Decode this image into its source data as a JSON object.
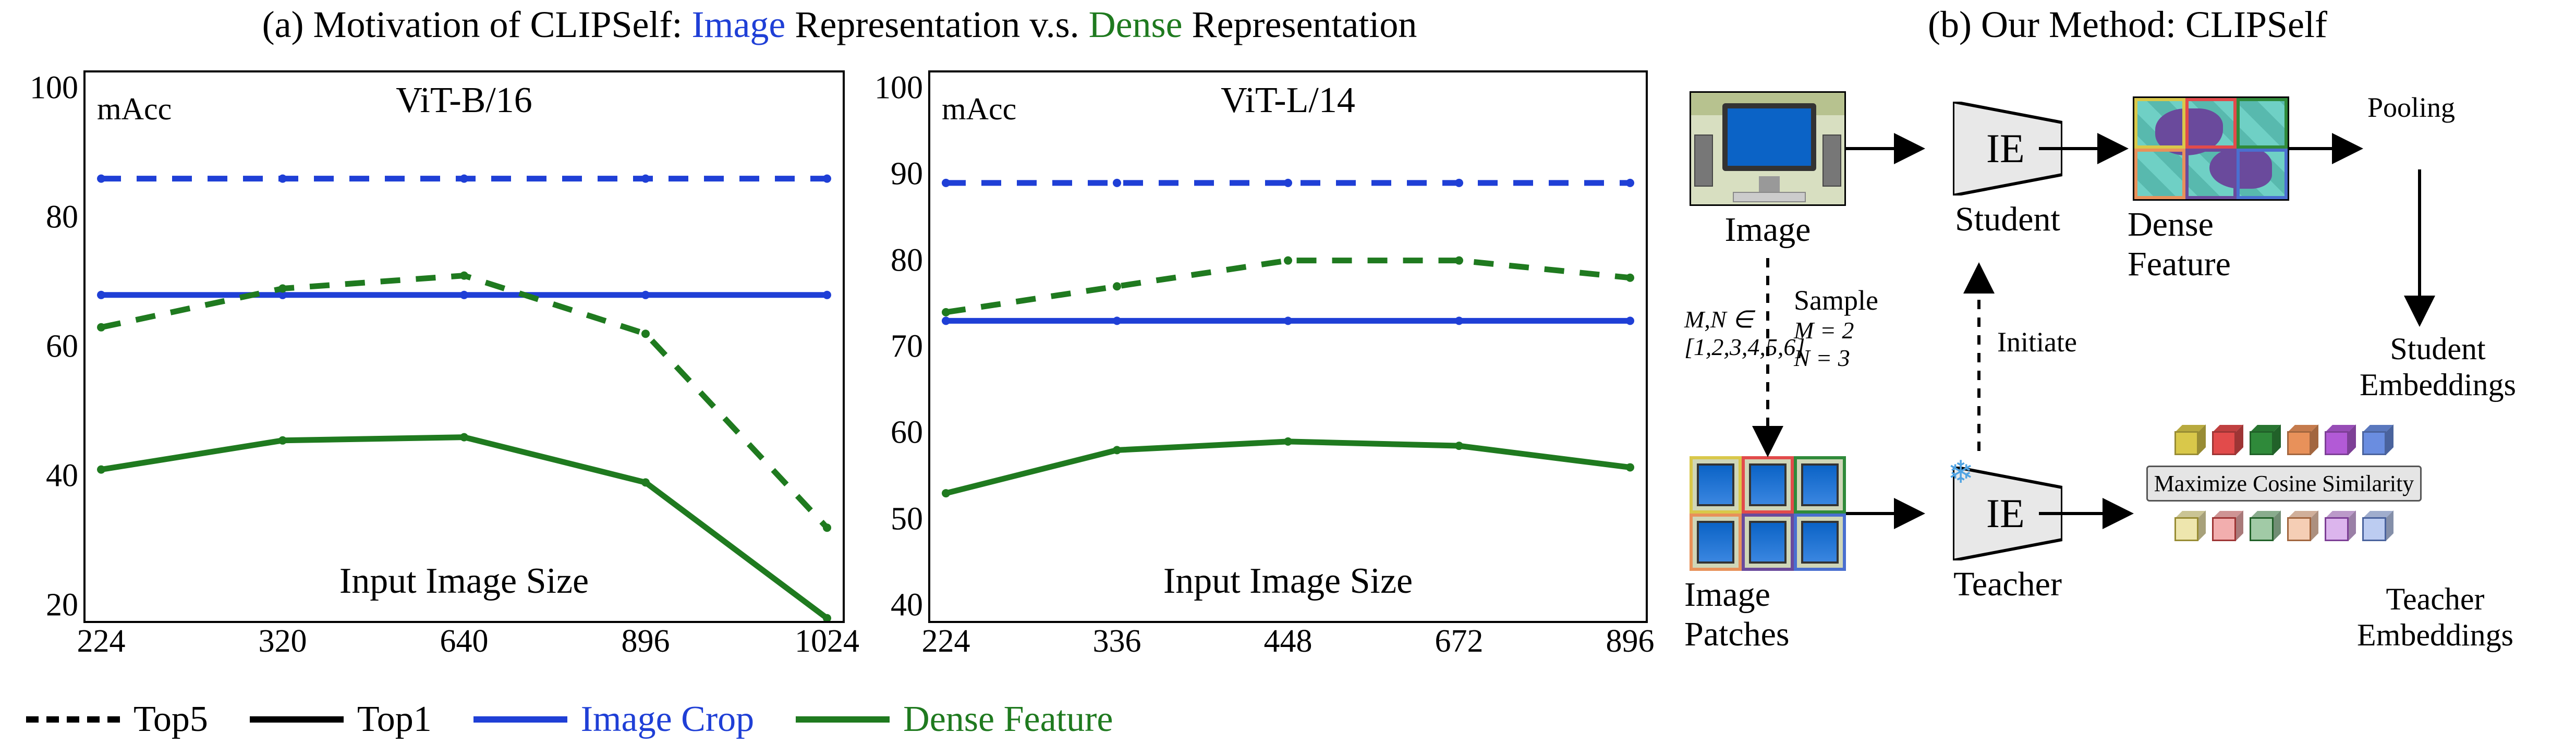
{
  "captions": {
    "a_pre": "(a) Motivation of CLIPSelf: ",
    "a_img": "Image",
    "a_mid": " Representation v.s. ",
    "a_dense": "Dense",
    "a_post": " Representation",
    "b": "(b) Our Method: CLIPSelf"
  },
  "legend": {
    "top5": "Top5",
    "top1": "Top1",
    "image_crop": "Image Crop",
    "dense_feature": "Dense Feature"
  },
  "chart_data": [
    {
      "type": "line",
      "title": "ViT-B/16",
      "macc": "mAcc",
      "xlabel": "Input Image Size",
      "ylabel": "",
      "ylim": [
        20,
        100
      ],
      "xticks": [
        "224",
        "320",
        "640",
        "896",
        "1024"
      ],
      "yticks": [
        20,
        40,
        60,
        80,
        100
      ],
      "series": [
        {
          "name": "Image Crop Top5",
          "color": "#1f3fd6",
          "dash": true,
          "values": [
            86,
            86,
            86,
            86,
            86
          ]
        },
        {
          "name": "Image Crop Top1",
          "color": "#1f3fd6",
          "dash": false,
          "values": [
            68,
            68,
            68,
            68,
            68
          ]
        },
        {
          "name": "Dense Feature Top5",
          "color": "#1f7a1f",
          "dash": true,
          "values": [
            63,
            69,
            71,
            62,
            32
          ]
        },
        {
          "name": "Dense Feature Top1",
          "color": "#1f7a1f",
          "dash": false,
          "values": [
            41,
            45.5,
            46,
            39,
            18
          ]
        }
      ]
    },
    {
      "type": "line",
      "title": "ViT-L/14",
      "macc": "mAcc",
      "xlabel": "Input Image Size",
      "ylabel": "",
      "ylim": [
        40,
        100
      ],
      "xticks": [
        "224",
        "336",
        "448",
        "672",
        "896"
      ],
      "yticks": [
        40,
        50,
        60,
        70,
        80,
        90,
        100
      ],
      "series": [
        {
          "name": "Image Crop Top5",
          "color": "#1f3fd6",
          "dash": true,
          "values": [
            89,
            89,
            89,
            89,
            89
          ]
        },
        {
          "name": "Image Crop Top1",
          "color": "#1f3fd6",
          "dash": false,
          "values": [
            73,
            73,
            73,
            73,
            73
          ]
        },
        {
          "name": "Dense Feature Top5",
          "color": "#1f7a1f",
          "dash": true,
          "values": [
            74,
            77,
            80,
            80,
            78
          ]
        },
        {
          "name": "Dense Feature Top1",
          "color": "#1f7a1f",
          "dash": false,
          "values": [
            53,
            58,
            59,
            58.5,
            56
          ]
        }
      ]
    }
  ],
  "diagram": {
    "image_label": "Image",
    "student_label": "Student",
    "dense_feature_label": "Dense Feature",
    "pooling_label": "Pooling",
    "student_emb_label": "Student Embeddings",
    "patches_label": "Image Patches",
    "teacher_label": "Teacher",
    "teacher_emb_label": "Teacher Embeddings",
    "initiate_label": "Initiate",
    "sample_label": "Sample",
    "mn_set": "M,N ∈",
    "mn_vals": "[1,2,3,4,5,6]",
    "m_eq": "M = 2",
    "n_eq": "N = 3",
    "ie": "IE",
    "sim": "Maximize Cosine Similarity",
    "cube_colors": [
      "#d9c84a",
      "#e24b4b",
      "#2f8a3a",
      "#e8915a",
      "#b25ad6",
      "#6a8de0"
    ],
    "cell_colors": [
      "#d9c84a",
      "#e24b4b",
      "#2f8a3a",
      "#e8915a",
      "#6a4a9c",
      "#4a6fd0"
    ]
  }
}
